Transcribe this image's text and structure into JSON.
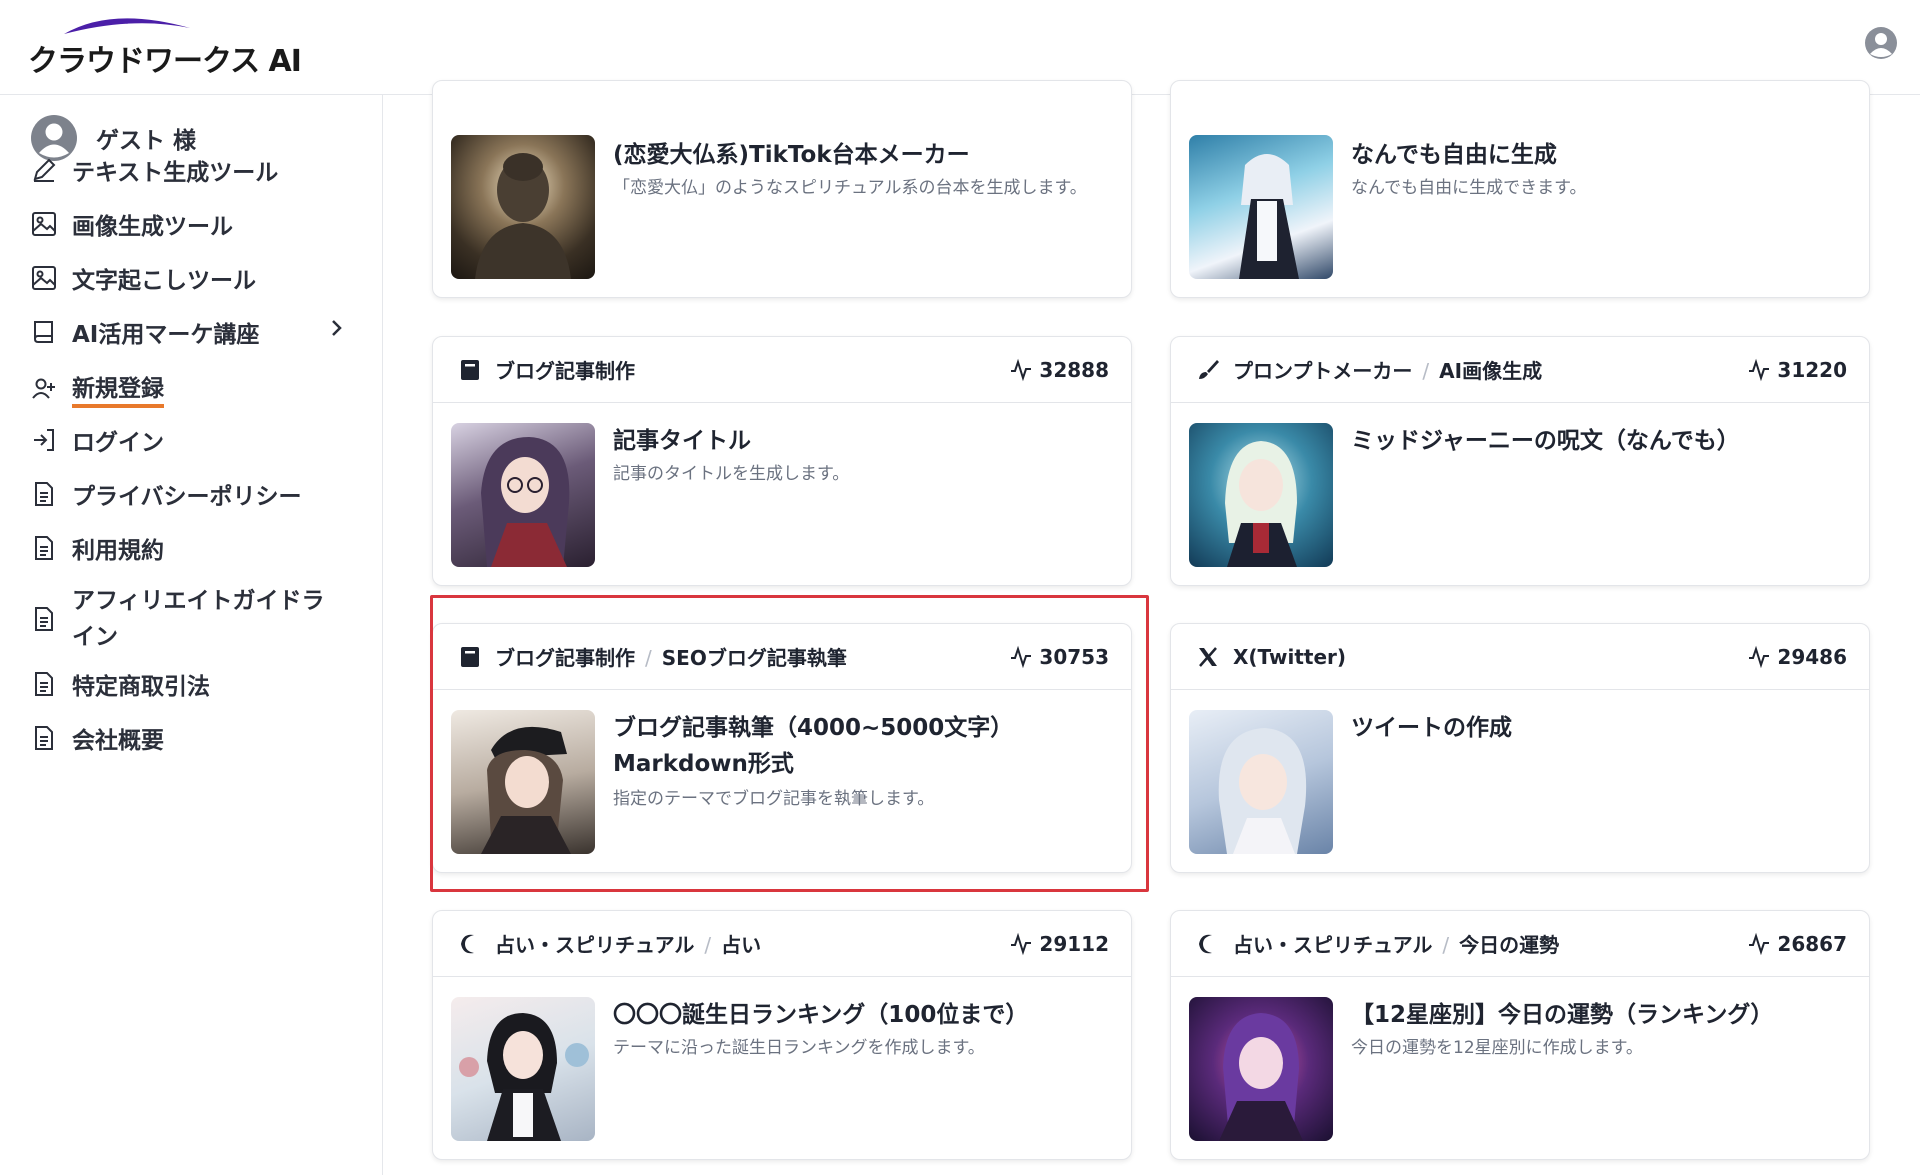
{
  "app": {
    "logo_text": "クラウドワークス AI"
  },
  "sidebar": {
    "user_name": "ゲスト 様",
    "items": [
      {
        "label": "テキスト生成ツール",
        "icon": "pencil-icon"
      },
      {
        "label": "画像生成ツール",
        "icon": "image-icon"
      },
      {
        "label": "文字起こしツール",
        "icon": "image-icon"
      },
      {
        "label": "AI活用マーケ講座",
        "icon": "book-icon"
      },
      {
        "label": "新規登録",
        "icon": "user-plus-icon"
      },
      {
        "label": "ログイン",
        "icon": "login-icon"
      },
      {
        "label": "プライバシーポリシー",
        "icon": "document-icon"
      },
      {
        "label": "利用規約",
        "icon": "document-icon"
      },
      {
        "label": "アフィリエイトガイドライン",
        "icon": "document-icon"
      },
      {
        "label": "特定商取引法",
        "icon": "document-icon"
      },
      {
        "label": "会社概要",
        "icon": "document-icon"
      }
    ]
  },
  "cards": [
    {
      "title": "(恋愛大仏系)TikTok台本メーカー",
      "desc": "「恋愛大仏」のようなスピリチュアル系の台本を生成します。",
      "thumb": "buddha-statue"
    },
    {
      "title": "なんでも自由に生成",
      "desc": "なんでも自由に生成できます。",
      "thumb": "anime-maid-butterflies"
    },
    {
      "category": "ブログ記事制作",
      "subcategory": "",
      "count": "32888",
      "cat_icon": "book-icon",
      "title": "記事タイトル",
      "desc": "記事のタイトルを生成します。",
      "thumb": "anime-girl-glasses"
    },
    {
      "category": "プロンプトメーカー",
      "subcategory": "AI画像生成",
      "count": "31220",
      "cat_icon": "brush-icon",
      "title": "ミッドジャーニーの呪文（なんでも）",
      "desc": "",
      "thumb": "anime-maid-magic"
    },
    {
      "category": "ブログ記事制作",
      "subcategory": "SEOブログ記事執筆",
      "count": "30753",
      "cat_icon": "book-icon",
      "title": "ブログ記事執筆（4000~5000文字）Markdown形式",
      "desc": "指定のテーマでブログ記事を執筆します。",
      "thumb": "anime-girl-cap"
    },
    {
      "category": "X(Twitter)",
      "subcategory": "",
      "count": "29486",
      "cat_icon": "x-logo-icon",
      "title": "ツイートの作成",
      "desc": "",
      "thumb": "anime-girl-silver-hair"
    },
    {
      "category": "占い・スピリチュアル",
      "subcategory": "占い",
      "count": "29112",
      "cat_icon": "moon-icon",
      "title": "〇〇〇誕生日ランキング（100位まで）",
      "desc": "テーマに沿った誕生日ランキングを作成します。",
      "thumb": "anime-maid-balloons"
    },
    {
      "category": "占い・スピリチュアル",
      "subcategory": "今日の運勢",
      "count": "26867",
      "cat_icon": "moon-icon",
      "title": "【12星座別】今日の運勢（ランキング）",
      "desc": "今日の運勢を12星座別に作成します。",
      "thumb": "anime-girl-purple-neon"
    }
  ],
  "colors": {
    "accent_underline": "#e8792b",
    "highlight_border": "#d9363e",
    "logo_swoosh": "#4b1fa8"
  }
}
